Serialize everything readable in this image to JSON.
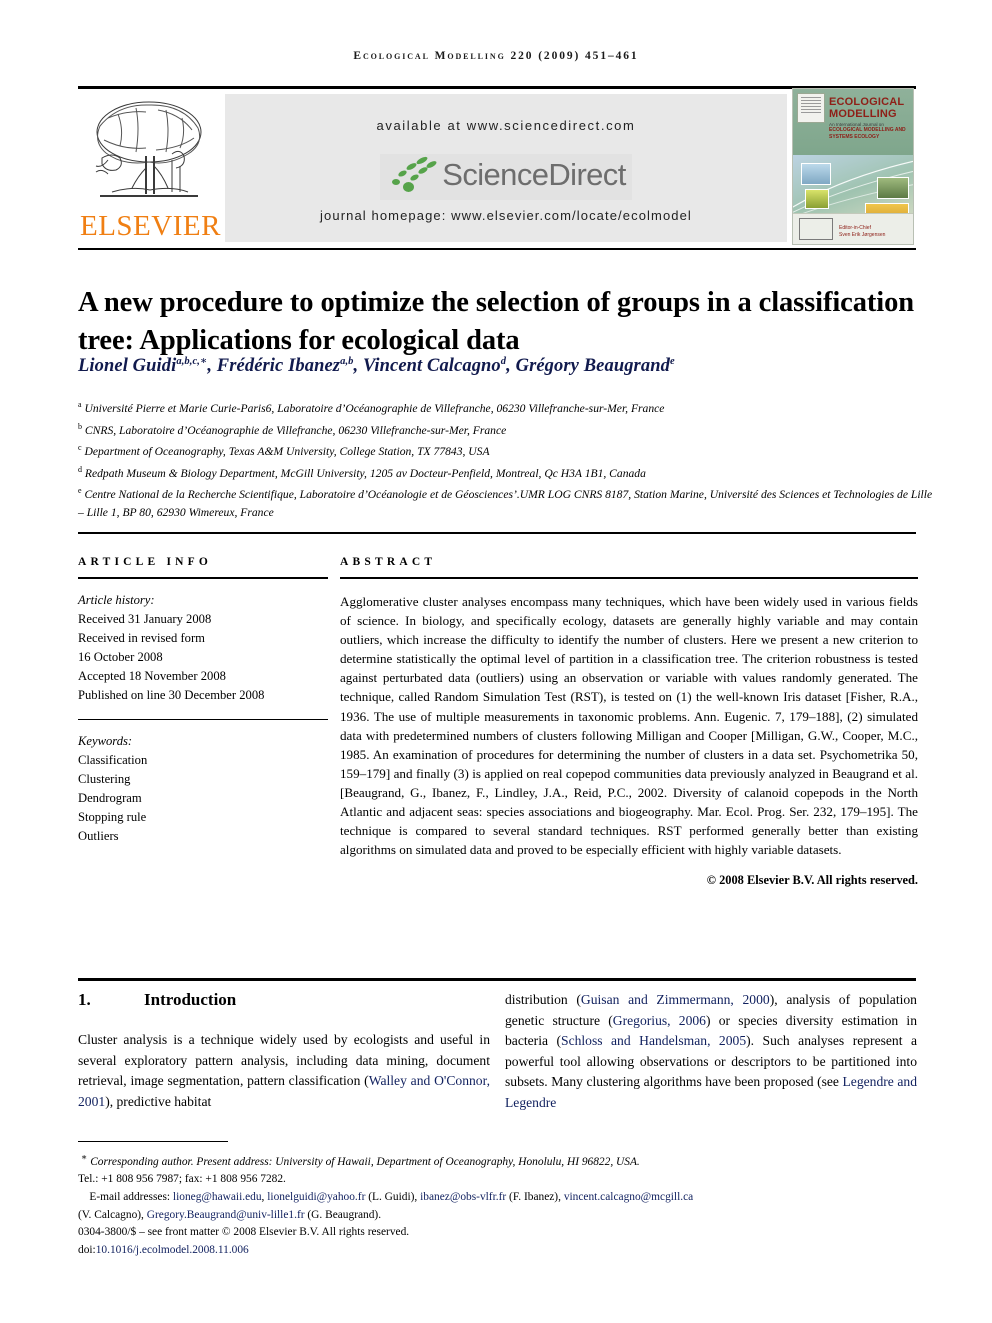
{
  "running_head": "Ecological Modelling 220 (2009) 451–461",
  "masthead": {
    "publisher_name": "ELSEVIER",
    "available_at": "available at www.sciencedirect.com",
    "sciencedirect_wordmark": "ScienceDirect",
    "journal_homepage": "journal homepage: www.elsevier.com/locate/ecolmodel",
    "cover": {
      "title_line1": "ECOLOGICAL",
      "title_line2": "MODELLING",
      "subtitle": "An International Journal on",
      "scope_line1": "ECOLOGICAL MODELLING AND",
      "scope_line2": "SYSTEMS ECOLOGY",
      "editor_label": "Editor-in-Chief",
      "editor_name": "Sven Erik Jørgensen",
      "imprint": "ELSEVIER"
    },
    "colors": {
      "elsevier_orange": "#F07F13",
      "sciencedirect_green": "#56a34a",
      "sciencedirect_gray": "#6d6d6d",
      "band_gray": "#e8e8e8",
      "cover_title_red": "#8e2018"
    }
  },
  "article": {
    "title": "A new procedure to optimize the selection of groups in a classification tree: Applications for ecological data",
    "authors_html": "Lionel Guidi<sup>a,b,c,∗</sup>, Frédéric Ibanez<sup>a,b</sup>, Vincent Calcagno<sup>d</sup>, Grégory Beaugrand<sup>e</sup>",
    "authors_plain": "Lionel Guidi a,b,c,*, Frédéric Ibanez a,b, Vincent Calcagno d, Grégory Beaugrand e",
    "affiliations": [
      {
        "marker": "a",
        "text": "Université Pierre et Marie Curie-Paris6, Laboratoire d’Océanographie de Villefranche, 06230 Villefranche-sur-Mer, France"
      },
      {
        "marker": "b",
        "text": "CNRS, Laboratoire d’Océanographie de Villefranche, 06230 Villefranche-sur-Mer, France"
      },
      {
        "marker": "c",
        "text": "Department of Oceanography, Texas A&M University, College Station, TX 77843, USA"
      },
      {
        "marker": "d",
        "text": "Redpath Museum & Biology Department, McGill University, 1205 av Docteur-Penfield, Montreal, Qc H3A 1B1, Canada"
      },
      {
        "marker": "e",
        "text": "Centre National de la Recherche Scientifique, Laboratoire d’Océanologie et de Géosciences’.UMR LOG CNRS 8187, Station Marine, Université des Sciences et Technologies de Lille – Lille 1, BP 80, 62930 Wimereux, France"
      }
    ]
  },
  "article_info": {
    "heading": "article info",
    "history_label": "Article history:",
    "history": [
      "Received 31 January 2008",
      "Received in revised form",
      "16 October 2008",
      "Accepted 18 November 2008",
      "Published on line 30 December 2008"
    ],
    "keywords_label": "Keywords:",
    "keywords": [
      "Classification",
      "Clustering",
      "Dendrogram",
      "Stopping rule",
      "Outliers"
    ]
  },
  "abstract": {
    "heading": "abstract",
    "text": "Agglomerative cluster analyses encompass many techniques, which have been widely used in various fields of science. In biology, and specifically ecology, datasets are generally highly variable and may contain outliers, which increase the difficulty to identify the number of clusters. Here we present a new criterion to determine statistically the optimal level of partition in a classification tree. The criterion robustness is tested against perturbated data (outliers) using an observation or variable with values randomly generated. The technique, called Random Simulation Test (RST), is tested on (1) the well-known Iris dataset [Fisher, R.A., 1936. The use of multiple measurements in taxonomic problems. Ann. Eugenic. 7, 179–188], (2) simulated data with predetermined numbers of clusters following Milligan and Cooper [Milligan, G.W., Cooper, M.C., 1985. An examination of procedures for determining the number of clusters in a data set. Psychometrika 50, 159–179] and finally (3) is applied on real copepod communities data previously analyzed in Beaugrand et al. [Beaugrand, G., Ibanez, F., Lindley, J.A., Reid, P.C., 2002. Diversity of calanoid copepods in the North Atlantic and adjacent seas: species associations and biogeography. Mar. Ecol. Prog. Ser. 232, 179–195]. The technique is compared to several standard techniques. RST performed generally better than existing algorithms on simulated data and proved to be especially efficient with highly variable datasets.",
    "copyright": "© 2008 Elsevier B.V. All rights reserved."
  },
  "introduction": {
    "number": "1.",
    "heading": "Introduction",
    "left_para_1": "Cluster analysis is a technique widely used by ecologists and useful in several exploratory pattern analysis, including data mining, document retrieval, image segmentation, pattern classification (",
    "left_cite_1": "Walley and O'Connor, 2001",
    "left_para_2": "), predictive habitat",
    "right_para_1": "distribution (",
    "right_cite_1": "Guisan and Zimmermann, 2000",
    "right_para_2": "), analysis of population genetic structure (",
    "right_cite_2": "Gregorius, 2006",
    "right_para_3": ") or species diversity estimation in bacteria (",
    "right_cite_3": "Schloss and Handelsman, 2005",
    "right_para_4": "). Such analyses represent a powerful tool allowing observations or descriptors to be partitioned into subsets. Many clustering algorithms have been proposed (see ",
    "right_cite_4": "Legendre and Legendre"
  },
  "footnote": {
    "corresponding_marker": "∗",
    "corresponding": "Corresponding author. Present address: University of Hawaii, Department of Oceanography, Honolulu, HI 96822, USA.",
    "tel_fax": "Tel.: +1 808 956 7987; fax: +1 808 956 7282.",
    "email_label": "E-mail addresses:",
    "emails_line1_a": "lioneg@hawaii.edu",
    "emails_line1_b": "lionelguidi@yahoo.fr",
    "emails_line1_name1": " (L. Guidi), ",
    "emails_line1_c": "ibanez@obs-vlfr.fr",
    "emails_line1_name2": " (F. Ibanez), ",
    "emails_line1_d": "vincent.calcagno@mcgill.ca",
    "emails_line2_name3": "(V. Calcagno), ",
    "emails_line2_e": "Gregory.Beaugrand@univ-lille1.fr",
    "emails_line2_name4": " (G. Beaugrand).",
    "issn_line": "0304-3800/$ – see front matter © 2008 Elsevier B.V. All rights reserved.",
    "doi_label": "doi:",
    "doi_value": "10.1016/j.ecolmodel.2008.11.006"
  }
}
